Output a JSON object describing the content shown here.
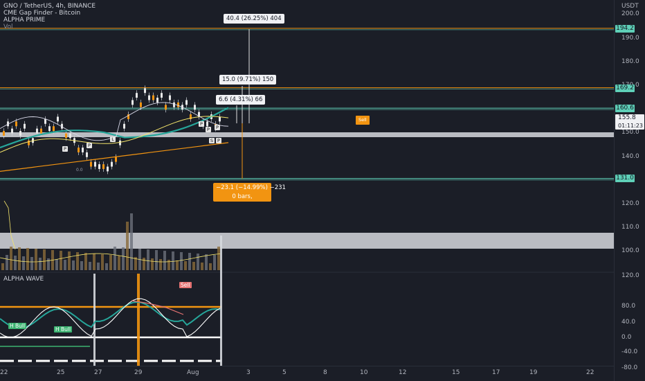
{
  "header": {
    "symbol_line": "GNO / TetherUS, 4h, BINANCE",
    "indicator_1": "CME Gap Finder - Bitcoin",
    "indicator_2": "ALPHA PRIME",
    "indicator_3": "Vol"
  },
  "price_axis": {
    "currency": "USDT",
    "ticks": [
      "200.0",
      "190.0",
      "180.0",
      "170.0",
      "150.0",
      "140.0",
      "120.0",
      "110.0",
      "100.0"
    ],
    "current_price": "155.8",
    "countdown": "01:11:23",
    "level_badges": [
      "194.2",
      "169.2",
      "160.6",
      "131.0"
    ]
  },
  "oscillator_axis": {
    "ticks": [
      "120.0",
      "80.0",
      "40.0",
      "0.0",
      "-40.0",
      "-80.0"
    ]
  },
  "time_axis": {
    "ticks": [
      "22",
      "25",
      "27",
      "29",
      "Aug",
      "3",
      "5",
      "8",
      "10",
      "12",
      "15",
      "17",
      "19",
      "22"
    ]
  },
  "measure_boxes": {
    "up_large": "40.4 (26.25%) 404",
    "up_mid": "15.0 (9.71%) 150",
    "up_small": "6.6 (4.31%) 66",
    "down_line1": "−23.1 (−14.99%) −231",
    "down_line2": "0 bars,"
  },
  "markers": {
    "pivot_letter": "P",
    "l_letter": "L",
    "s_letter": "S",
    "tiny_low_text": "0.0",
    "sell_tag": "Sell",
    "wave_sell_tag": "Sell",
    "wave_bull_1": "H Bull",
    "wave_bull_2": "H Bull"
  },
  "wave_pane": {
    "title": "ALPHA WAVE"
  },
  "colors": {
    "background": "#1b1e27",
    "teal_ma": "#26a69a",
    "yellow_line": "#f5e56b",
    "orange": "#f29411",
    "level_line": "#5fd0b8",
    "bull_green": "#3cb371",
    "sell_red": "#e57373"
  }
}
